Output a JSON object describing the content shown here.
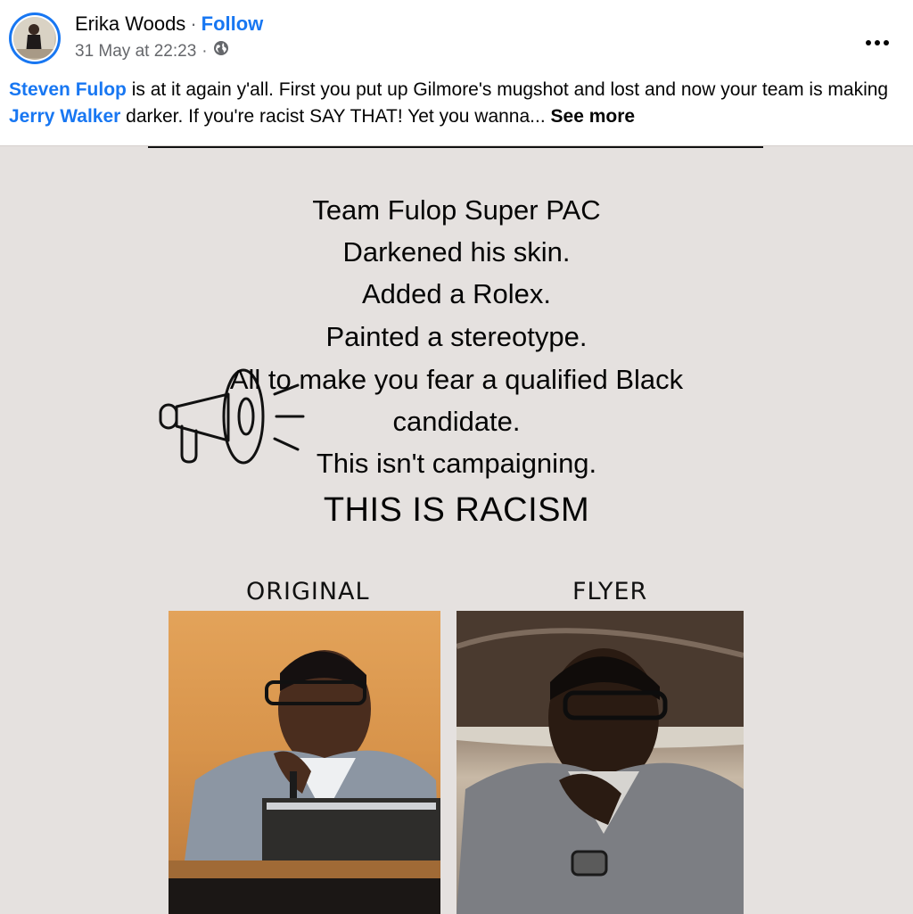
{
  "post": {
    "author": "Erika Woods",
    "separator": "·",
    "follow_label": "Follow",
    "timestamp": "31 May at 22:23",
    "separator2": "·",
    "audience_icon": "globe-icon",
    "more_icon": "more-options-icon",
    "text": {
      "mention1": "Steven Fulop",
      "part1": " is at it again y'all. First you put up Gilmore's mugshot and lost and now your team is making ",
      "mention2": "Jerry Walker",
      "part2": " darker. If you're racist SAY THAT! Yet you wanna... ",
      "see_more": "See more"
    }
  },
  "flyer": {
    "lines": [
      "Team Fulop Super PAC",
      "Darkened his skin.",
      "Added a Rolex.",
      "Painted a stereotype.",
      "All to make you fear a qualified Black",
      "candidate.",
      "This isn't campaigning."
    ],
    "headline": "THIS IS RACISM",
    "label_left": "ORIGINAL",
    "label_right": "FLYER"
  },
  "colors": {
    "link": "#1877f2",
    "secondary": "#65676b",
    "flyer_bg": "#e5e1df"
  }
}
